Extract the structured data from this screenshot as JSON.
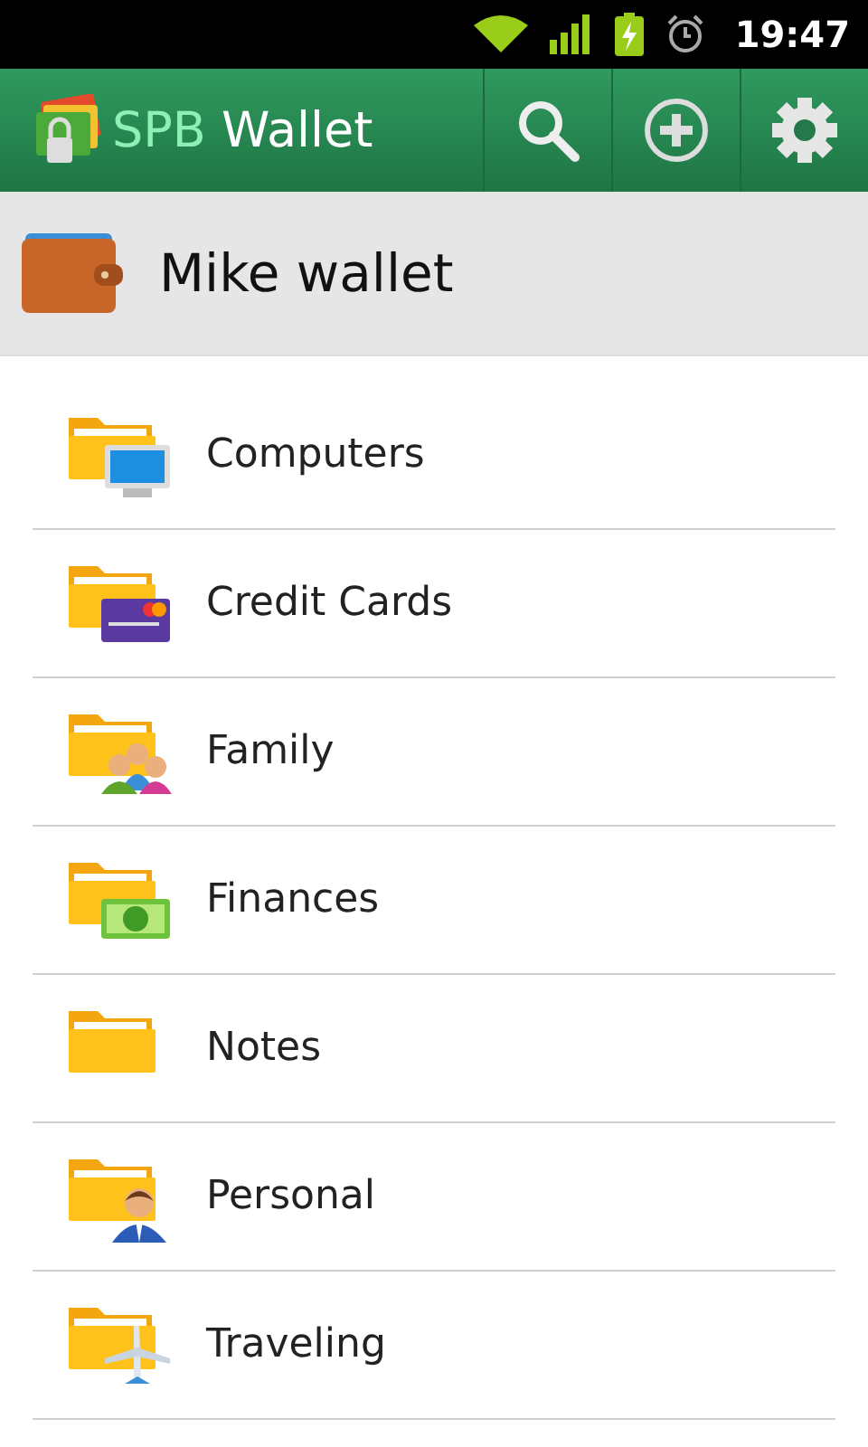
{
  "status_bar": {
    "time": "19:47"
  },
  "action_bar": {
    "title_brand": "SPB",
    "title_name": "Wallet"
  },
  "wallet": {
    "name": "Mike wallet"
  },
  "folders": [
    {
      "label": "Computers",
      "kind": "monitor"
    },
    {
      "label": "Credit Cards",
      "kind": "card"
    },
    {
      "label": "Family",
      "kind": "people"
    },
    {
      "label": "Finances",
      "kind": "money"
    },
    {
      "label": "Notes",
      "kind": "plain"
    },
    {
      "label": "Personal",
      "kind": "person"
    },
    {
      "label": "Traveling",
      "kind": "plane"
    }
  ]
}
